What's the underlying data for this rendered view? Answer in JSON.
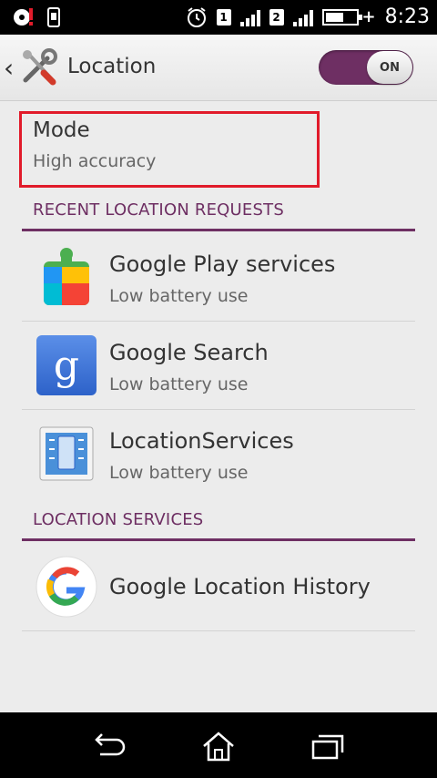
{
  "status_bar": {
    "time": "8:23",
    "sim1": "1",
    "sim2": "2",
    "battery_level": 0.6,
    "icons": [
      "notification-icon",
      "phone-icon",
      "alarm-icon",
      "sim1-signal-icon",
      "sim2-signal-icon",
      "battery-icon"
    ]
  },
  "header": {
    "title": "Location",
    "toggle_label": "ON",
    "toggle_on": true
  },
  "mode": {
    "title": "Mode",
    "value": "High accuracy"
  },
  "recent": {
    "header": "RECENT LOCATION REQUESTS",
    "items": [
      {
        "title": "Google Play services",
        "subtitle": "Low battery use",
        "icon": "google-play-services-icon"
      },
      {
        "title": "Google Search",
        "subtitle": "Low battery use",
        "icon": "google-search-icon"
      },
      {
        "title": "LocationServices",
        "subtitle": "Low battery use",
        "icon": "location-services-icon"
      }
    ]
  },
  "services": {
    "header": "LOCATION SERVICES",
    "items": [
      {
        "title": "Google Location History",
        "icon": "google-g-icon"
      }
    ]
  },
  "nav": {
    "buttons": [
      "back-icon",
      "home-icon",
      "recent-apps-icon"
    ]
  },
  "colors": {
    "accent": "#6e2f63",
    "highlight": "#e11b2a",
    "background": "#ececec"
  }
}
